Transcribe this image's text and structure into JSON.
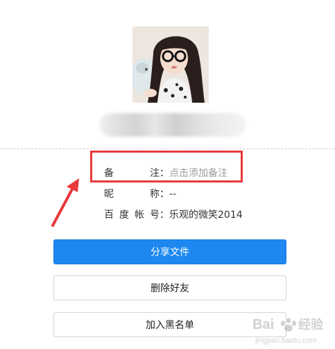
{
  "profile": {
    "avatar_alt": "用户头像"
  },
  "info": {
    "remark_label": "备注",
    "remark_value": "点击添加备注",
    "nickname_label": "昵称",
    "nickname_value": "--",
    "account_label": "百度帐号",
    "account_value": "乐观的微笑2014",
    "colon": "："
  },
  "actions": {
    "share_label": "分享文件",
    "delete_label": "删除好友",
    "block_label": "加入黑名单"
  },
  "watermark": {
    "text": "Bai 经验",
    "subtext": "jingyan.baidu.com"
  },
  "colors": {
    "primary_button": "#1e88f0",
    "highlight_box": "#e8393b",
    "arrow": "#e8393b",
    "placeholder_text": "#9a9a9a"
  }
}
